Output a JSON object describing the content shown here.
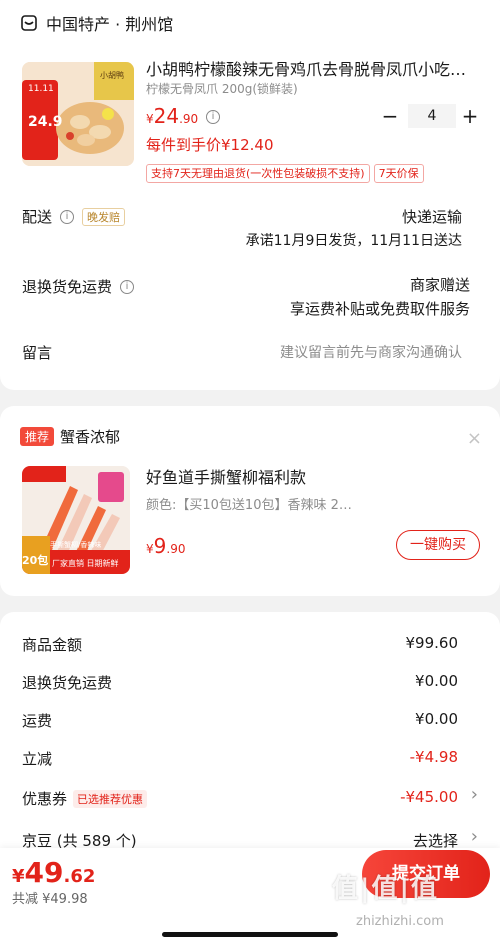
{
  "shop": {
    "name": "中国特产 · 荆州馆",
    "icon": "shop-icon"
  },
  "product": {
    "title": "小胡鸭柠檬酸辣无骨鸡爪去骨脱骨凤爪小吃…",
    "spec": "柠檬无骨凤爪 200g(锁鲜装)",
    "price_symbol": "¥",
    "price_int": "24",
    "price_dec": ".90",
    "unit_price": "每件到手价¥12.40",
    "quantity": "4",
    "minus": "−",
    "plus": "+",
    "tags": [
      "支持7天无理由退货(一次性包装破损不支持)",
      "7天价保"
    ],
    "thumb_badge": "11.11",
    "thumb_price": "24.9",
    "thumb_brand": "小胡鸭"
  },
  "delivery": {
    "label": "配送",
    "tag": "晚发赔",
    "method": "快递运输",
    "promise": "承诺11月9日发货，11月11日送达"
  },
  "return_shipping": {
    "label": "退换货免运费",
    "value1": "商家赠送",
    "value2": "享运费补贴或免费取件服务"
  },
  "note": {
    "label": "留言",
    "placeholder": "建议留言前先与商家沟通确认"
  },
  "recommend": {
    "tag": "推荐",
    "title": "蟹香浓郁",
    "close": "×",
    "product_title": "好鱼道手撕蟹柳福利款",
    "spec": "颜色:【买10包送10包】香辣味 2…",
    "price_symbol": "¥",
    "price_int": "9",
    "price_dec": ".90",
    "buy_label": "一键购买",
    "thumb_line1": "20包",
    "thumb_line2": "厂家直销 日期新鲜",
    "thumb_line3": "手撕蟹柳/香辣味"
  },
  "summary": {
    "rows": [
      {
        "label": "商品金额",
        "value": "¥99.60"
      },
      {
        "label": "退换货免运费",
        "value": "¥0.00"
      },
      {
        "label": "运费",
        "value": "¥0.00"
      },
      {
        "label": "立减",
        "value": "-¥4.98"
      },
      {
        "label": "优惠券",
        "tag": "已选推荐优惠",
        "value": "-¥45.00"
      },
      {
        "label": "京豆 (共 589 个)",
        "value": "去选择"
      }
    ],
    "chevron": "›"
  },
  "footer": {
    "total_symbol": "¥",
    "total_int": "49",
    "total_dec": ".62",
    "saving": "共减 ¥49.98",
    "submit_label": "提交订单",
    "watermark": "值|值|值",
    "watermark_url": "zhizhizhi.com"
  },
  "colors": {
    "accent": "#e2231a",
    "tag_bg": "#fdecea"
  }
}
